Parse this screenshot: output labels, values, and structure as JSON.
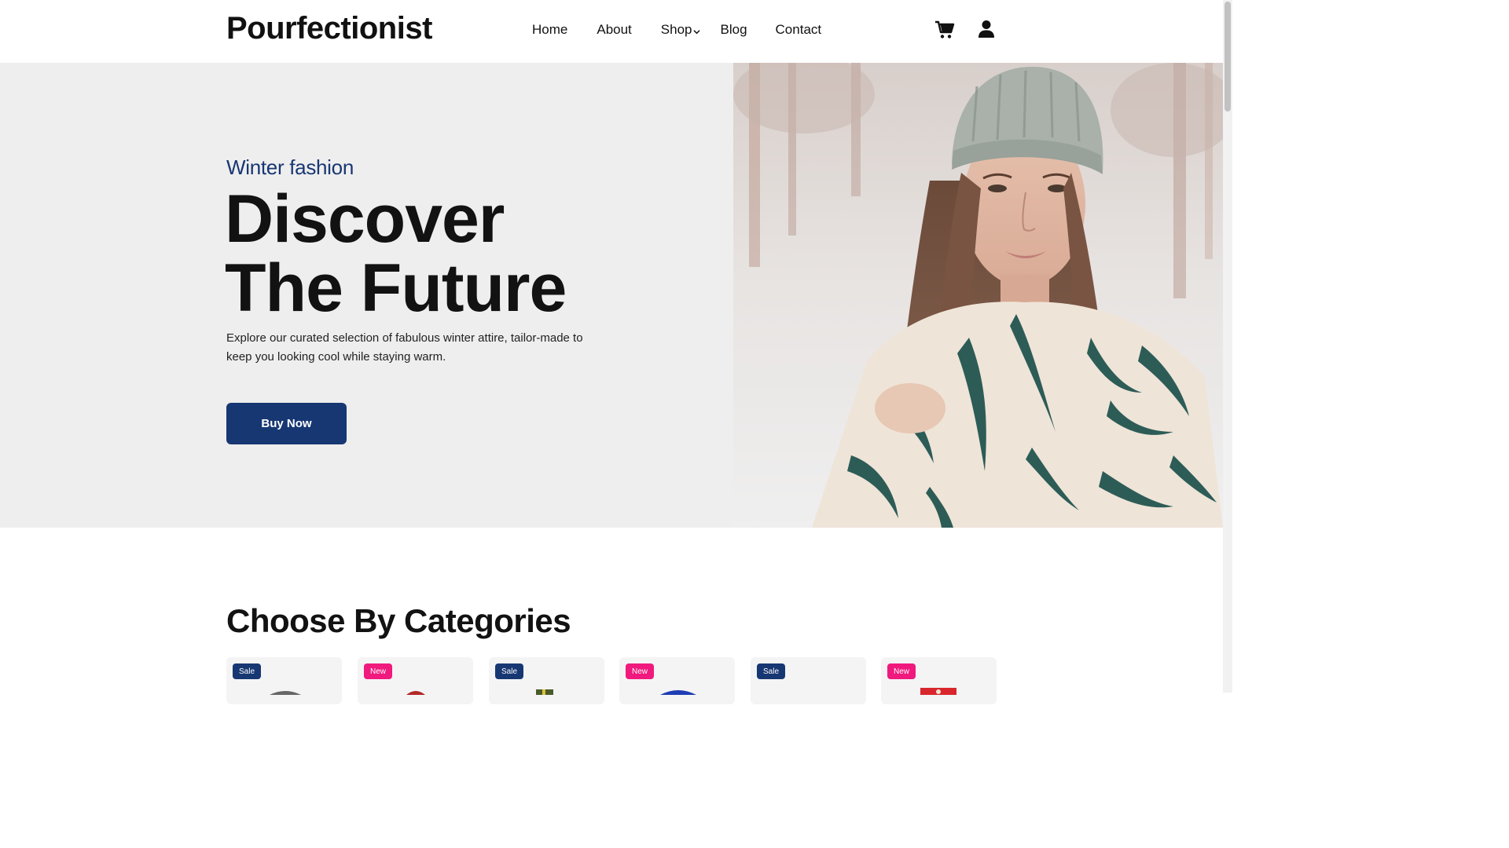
{
  "header": {
    "logo": "Pourfectionist",
    "nav": [
      {
        "label": "Home"
      },
      {
        "label": "About"
      },
      {
        "label": "Shop"
      },
      {
        "label": "Blog"
      },
      {
        "label": "Contact"
      }
    ],
    "icons": {
      "cart": "cart-icon",
      "user": "user-icon",
      "dropdown": "chevron-down-icon"
    }
  },
  "hero": {
    "eyebrow": "Winter fashion",
    "title_line1": "Discover",
    "title_line2": "The Future",
    "description": "Explore our curated selection of fabulous winter attire, tailor-made to keep you looking cool while staying warm.",
    "cta": "Buy Now"
  },
  "categories": {
    "title": "Choose By Categories",
    "cards": [
      {
        "badge": "Sale"
      },
      {
        "badge": "New"
      },
      {
        "badge": "Sale"
      },
      {
        "badge": "New"
      },
      {
        "badge": "Sale"
      },
      {
        "badge": "New"
      }
    ]
  },
  "colors": {
    "primary": "#173773",
    "new_badge": "#f0197d",
    "hero_bg": "#efeeee",
    "text": "#111111"
  }
}
